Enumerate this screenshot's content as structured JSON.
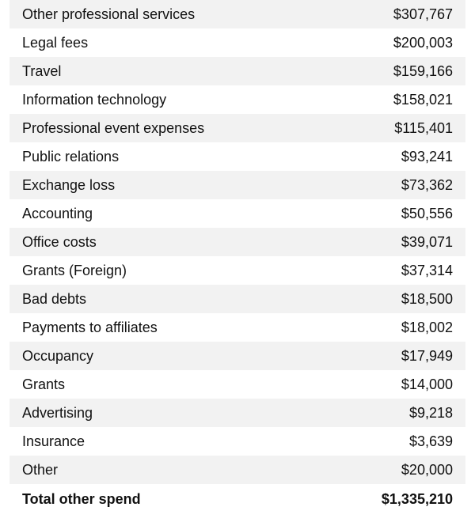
{
  "table": {
    "name": "other-spend-breakdown",
    "colors": {
      "shaded_row": "#f2f2f2",
      "plain_row": "#ffffff",
      "text": "#111111"
    },
    "rows": [
      {
        "label": "Other professional services",
        "value": "$307,767",
        "shaded": true
      },
      {
        "label": "Legal fees",
        "value": "$200,003",
        "shaded": false
      },
      {
        "label": "Travel",
        "value": "$159,166",
        "shaded": true
      },
      {
        "label": "Information technology",
        "value": "$158,021",
        "shaded": false
      },
      {
        "label": "Professional event expenses",
        "value": "$115,401",
        "shaded": true
      },
      {
        "label": "Public relations",
        "value": "$93,241",
        "shaded": false
      },
      {
        "label": "Exchange loss",
        "value": "$73,362",
        "shaded": true
      },
      {
        "label": "Accounting",
        "value": "$50,556",
        "shaded": false
      },
      {
        "label": "Office costs",
        "value": "$39,071",
        "shaded": true
      },
      {
        "label": "Grants (Foreign)",
        "value": "$37,314",
        "shaded": false
      },
      {
        "label": "Bad debts",
        "value": "$18,500",
        "shaded": true
      },
      {
        "label": "Payments to affiliates",
        "value": "$18,002",
        "shaded": false
      },
      {
        "label": "Occupancy",
        "value": "$17,949",
        "shaded": true
      },
      {
        "label": "Grants",
        "value": "$14,000",
        "shaded": false
      },
      {
        "label": "Advertising",
        "value": "$9,218",
        "shaded": true
      },
      {
        "label": "Insurance",
        "value": "$3,639",
        "shaded": false
      },
      {
        "label": "Other",
        "value": "$20,000",
        "shaded": true
      }
    ],
    "total": {
      "label": "Total other spend",
      "value": "$1,335,210"
    }
  }
}
